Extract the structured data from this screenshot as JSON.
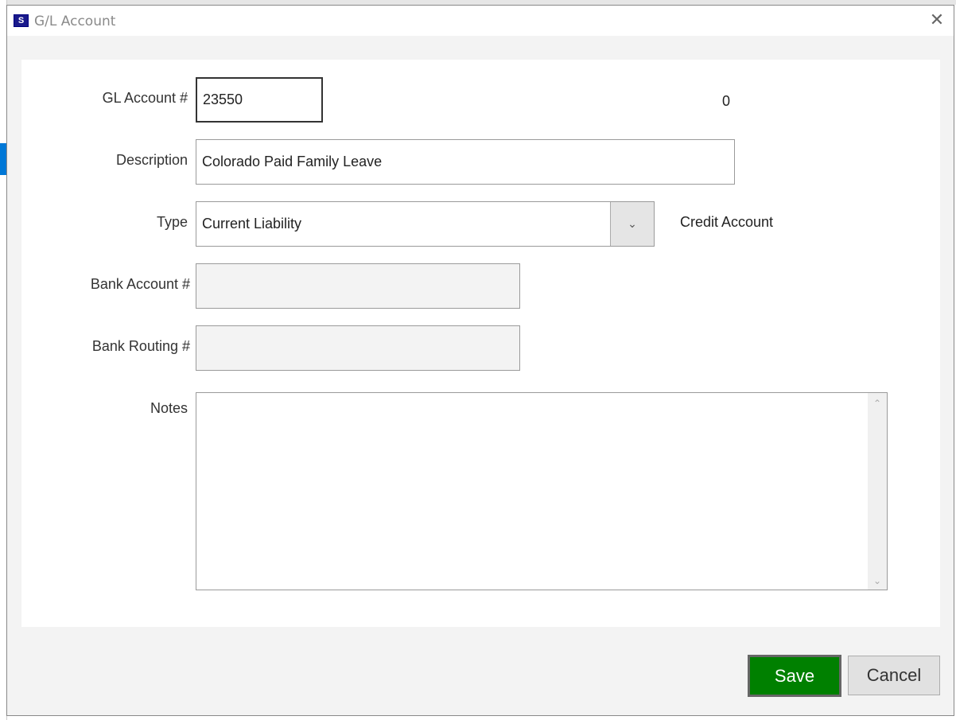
{
  "dialog": {
    "title": "G/L Account",
    "icon": "app-s-icon",
    "close": "✕"
  },
  "form": {
    "gl_account_label": "GL Account #",
    "gl_account_value": "23550",
    "gl_counter": "0",
    "description_label": "Description",
    "description_value": "Colorado Paid Family Leave",
    "type_label": "Type",
    "type_value": "Current Liability",
    "type_side_text": "Credit Account",
    "bank_account_label": "Bank Account #",
    "bank_account_value": "",
    "bank_routing_label": "Bank Routing #",
    "bank_routing_value": "",
    "notes_label": "Notes",
    "notes_value": ""
  },
  "buttons": {
    "save": "Save",
    "cancel": "Cancel"
  },
  "colors": {
    "save": "#008000",
    "cancel": "#e1e1e1"
  }
}
